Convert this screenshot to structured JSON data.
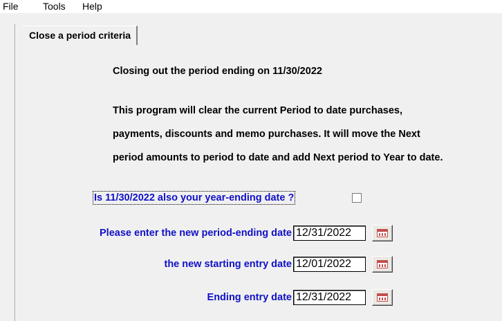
{
  "menu": [
    "File",
    "Tools",
    "Help"
  ],
  "tab": {
    "label": "Close a period criteria"
  },
  "content": {
    "closing_line": "Closing out the period ending on 11/30/2022",
    "desc_lines": [
      "This program will clear the current Period to date purchases,",
      "payments, discounts and memo purchases. It will move the Next",
      "period amounts to period to date and add Next period to Year to date."
    ],
    "year_end_question": "Is 11/30/2022 also your year-ending date ?",
    "year_end_checked": false
  },
  "fields": [
    {
      "label": "Please enter the new period-ending date",
      "value": "12/31/2022"
    },
    {
      "label": "the new starting entry date",
      "value": "12/01/2022"
    },
    {
      "label": "Ending entry date",
      "value": "12/31/2022"
    }
  ],
  "colors": {
    "label_blue": "#1010c8",
    "calendar_red": "#c0504d"
  },
  "icons": {
    "date_picker": "calendar-icon"
  }
}
